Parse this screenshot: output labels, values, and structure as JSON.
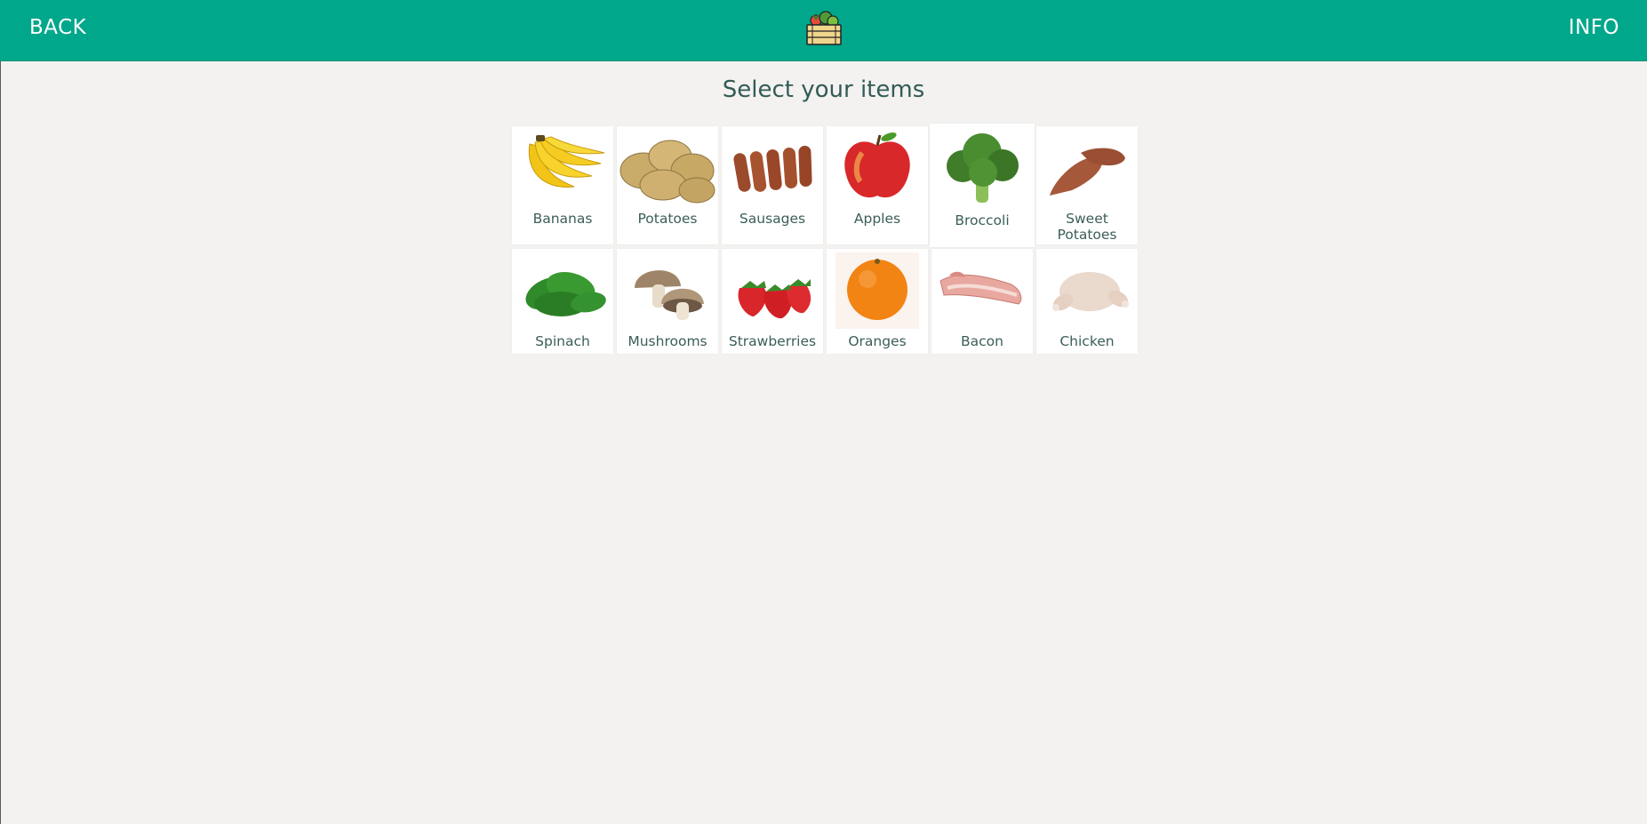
{
  "header": {
    "back_label": "BACK",
    "info_label": "INFO",
    "logo_icon": "crate-of-vegetables-icon",
    "accent_color": "#00a78a"
  },
  "main": {
    "title": "Select your items",
    "items": [
      {
        "label": "Bananas",
        "icon": "banana-icon"
      },
      {
        "label": "Potatoes",
        "icon": "potato-icon"
      },
      {
        "label": "Sausages",
        "icon": "sausage-icon"
      },
      {
        "label": "Apples",
        "icon": "apple-icon"
      },
      {
        "label": "Broccoli",
        "icon": "broccoli-icon"
      },
      {
        "label": "Sweet Potatoes",
        "icon": "sweet-potato-icon"
      },
      {
        "label": "Spinach",
        "icon": "spinach-icon"
      },
      {
        "label": "Mushrooms",
        "icon": "mushroom-icon"
      },
      {
        "label": "Strawberries",
        "icon": "strawberry-icon"
      },
      {
        "label": "Oranges",
        "icon": "orange-icon"
      },
      {
        "label": "Bacon",
        "icon": "bacon-icon"
      },
      {
        "label": "Chicken",
        "icon": "chicken-icon"
      }
    ]
  }
}
